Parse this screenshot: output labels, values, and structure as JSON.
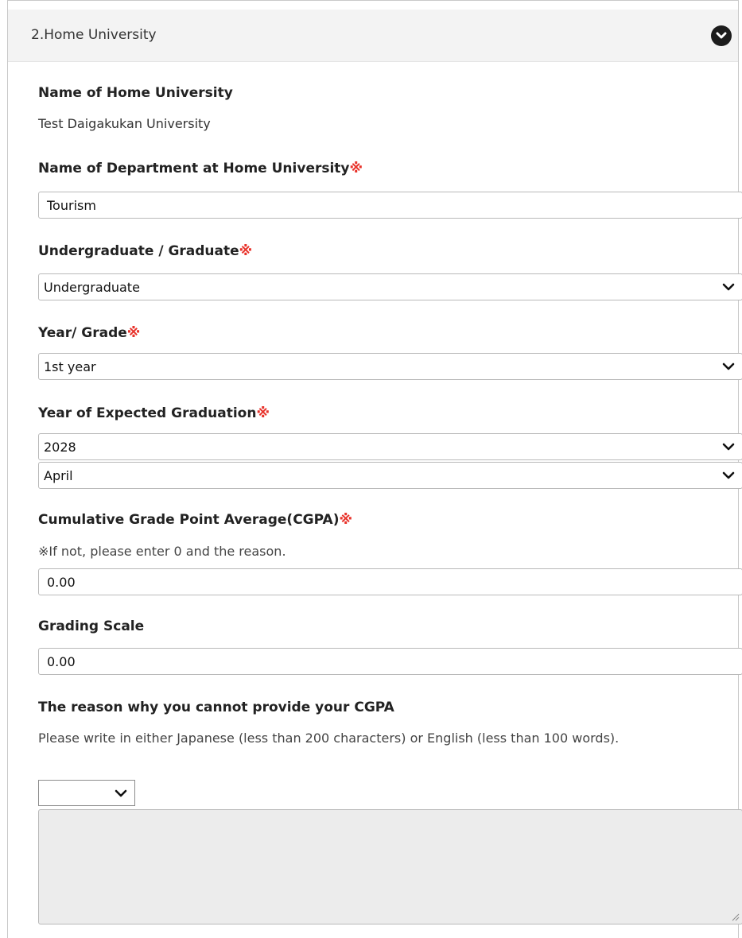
{
  "section": {
    "title": "2.Home University"
  },
  "required_mark": "※",
  "home_university": {
    "label": "Name of Home University",
    "value": "Test Daigakukan University"
  },
  "department": {
    "label": "Name of Department at Home University",
    "value": "Tourism"
  },
  "level": {
    "label": "Undergraduate / Graduate",
    "selected": "Undergraduate"
  },
  "year_grade": {
    "label": "Year/ Grade",
    "selected": "1st year"
  },
  "expected_graduation": {
    "label": "Year of Expected Graduation",
    "year_selected": "2028",
    "month_selected": "April"
  },
  "cgpa": {
    "label": "Cumulative Grade Point Average(CGPA)",
    "note": "※If not, please enter 0 and the reason.",
    "value": "0.00"
  },
  "grading_scale": {
    "label": "Grading Scale",
    "value": "0.00"
  },
  "cgpa_reason": {
    "label": "The reason why you cannot provide your CGPA",
    "note": "Please write in either Japanese (less than 200 characters) or English (less than 100 words).",
    "language_selected": "",
    "text": ""
  },
  "icons": {
    "toggle": "chevron-down-circle-icon",
    "select_arrow": "chevron-down-icon",
    "resize": "resize-grip-icon"
  },
  "colors": {
    "required": "#e8322a",
    "header_bg": "#f3f3f3",
    "textarea_bg": "#ececec"
  }
}
